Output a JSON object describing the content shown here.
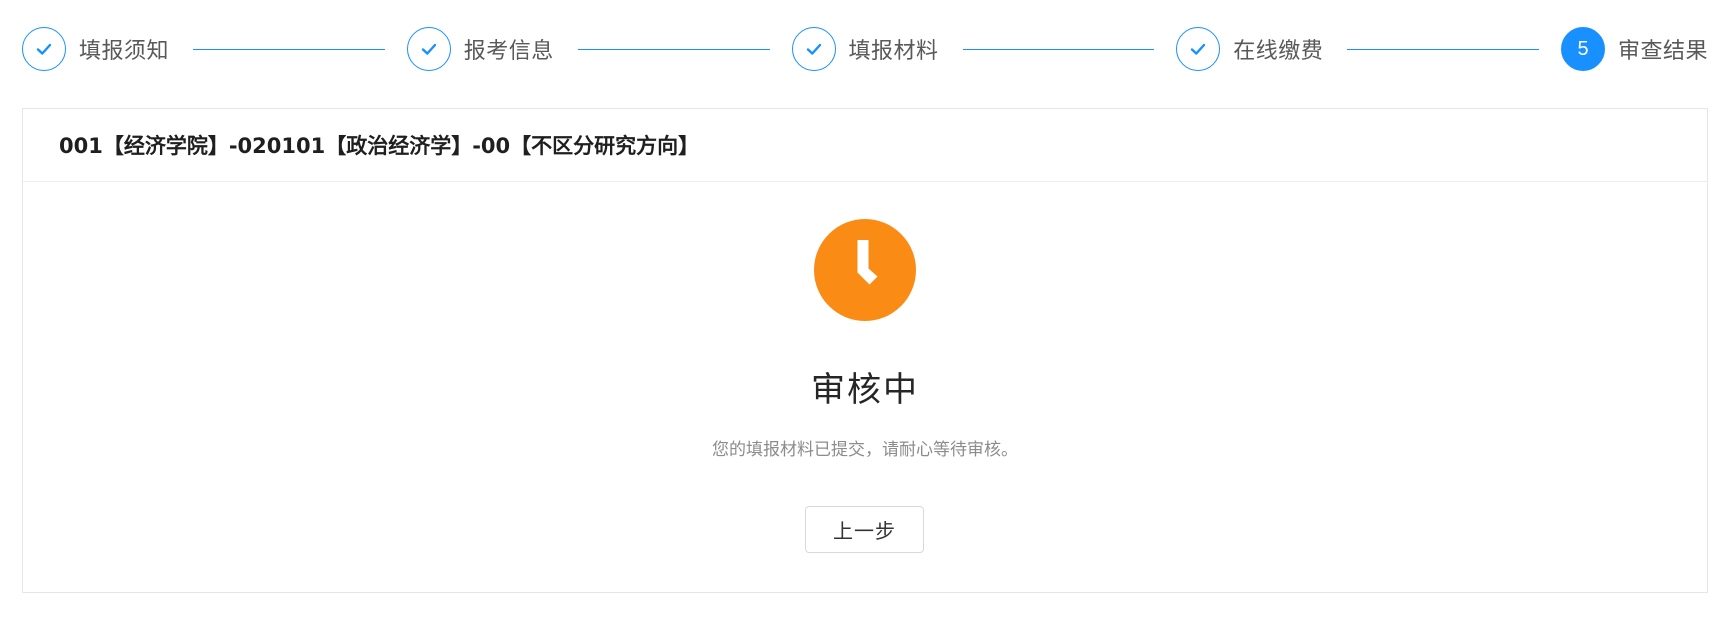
{
  "steps": [
    {
      "label": "填报须知",
      "status": "finished",
      "icon": "check-icon"
    },
    {
      "label": "报考信息",
      "status": "finished",
      "icon": "check-icon"
    },
    {
      "label": "填报材料",
      "status": "finished",
      "icon": "check-icon"
    },
    {
      "label": "在线缴费",
      "status": "finished",
      "icon": "check-icon"
    },
    {
      "label": "审查结果",
      "status": "active",
      "number": "5"
    }
  ],
  "card": {
    "header": "001【经济学院】-020101【政治经济学】-00【不区分研究方向】"
  },
  "result": {
    "icon": "clock-icon",
    "title": "审核中",
    "subtitle": "您的填报材料已提交，请耐心等待审核。",
    "prev_button_label": "上一步"
  },
  "colors": {
    "primary": "#1890ff",
    "warning": "#fa8c16",
    "border": "#e6e6e6",
    "step_text": "#595959",
    "subtitle_text": "#8c8c8c"
  }
}
